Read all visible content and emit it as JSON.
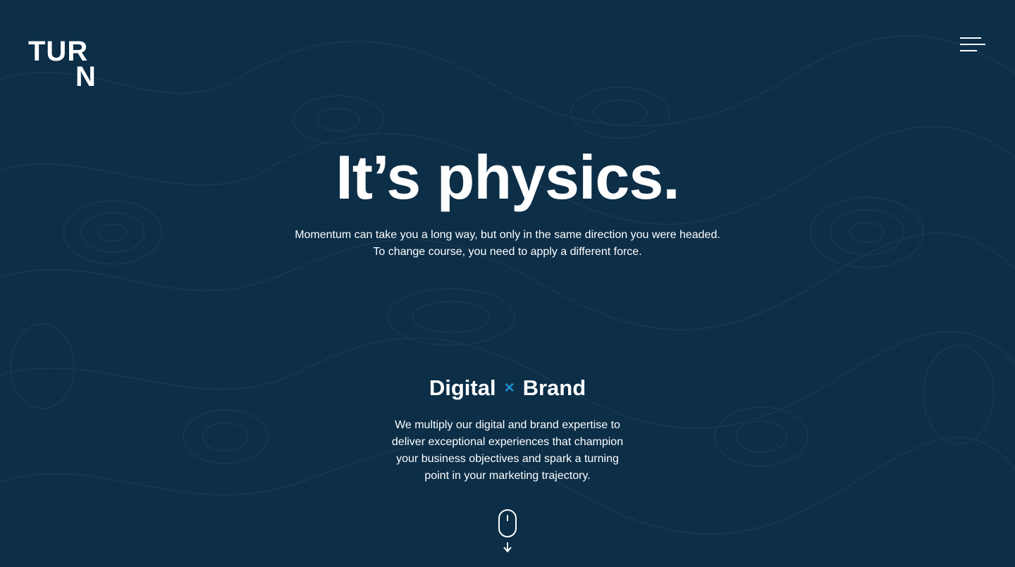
{
  "header": {
    "logo_line1": "TUR",
    "logo_line2": "N"
  },
  "menu": {
    "icon": "hamburger-menu-icon"
  },
  "hero": {
    "title": "It’s physics.",
    "line1": "Momentum can take you a long way, but only in the same direction you were headed.",
    "line2": "To change course, you need to apply a different force."
  },
  "services": {
    "word_left": "Digital",
    "symbol": "×",
    "word_right": "Brand",
    "description": "We multiply our digital and brand expertise to deliver exceptional experiences that champion your business objectives and spark a turning point in your marketing trajectory."
  },
  "scroll": {
    "icon": "mouse-scroll-down-icon"
  },
  "colors": {
    "background": "#0c2e47",
    "accent": "#1d8fd6",
    "text": "#ffffff"
  }
}
